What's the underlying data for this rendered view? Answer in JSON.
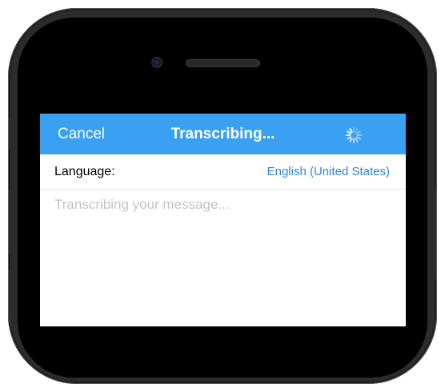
{
  "nav": {
    "cancel_label": "Cancel",
    "title": "Transcribing...",
    "spinner_icon": "activity-spinner-icon"
  },
  "language_row": {
    "label": "Language:",
    "value": "English (United States)"
  },
  "message": {
    "value": "",
    "placeholder": "Transcribing your message..."
  },
  "colors": {
    "nav_background": "#3aa0f2",
    "link": "#2d84d9",
    "placeholder": "#c4c4c8"
  }
}
